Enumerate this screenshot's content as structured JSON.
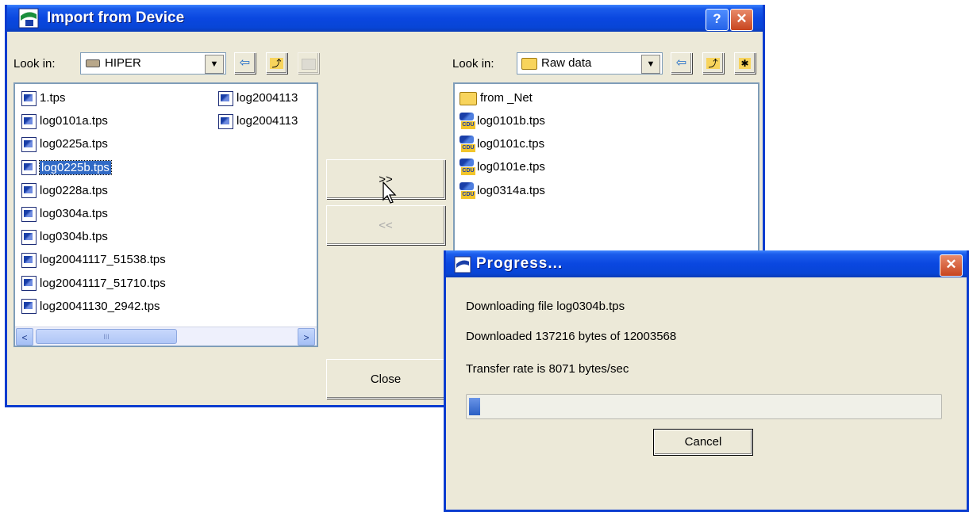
{
  "import_dialog": {
    "title": "Import from Device",
    "help_label": "?",
    "close_glyph": "✕",
    "left": {
      "look_in_label": "Look in:",
      "location": "HIPER",
      "back_icon": "⇦",
      "up_icon": "⤴",
      "files_col1": [
        "1.tps",
        "log0101a.tps",
        "log0225a.tps",
        "log0225b.tps",
        "log0228a.tps",
        "log0304a.tps",
        "log0304b.tps",
        "log20041117_51538.tps",
        "log20041117_51710.tps",
        "log20041130_2942.tps"
      ],
      "files_col2": [
        "log2004113",
        "log2004113"
      ],
      "selected": "log0225b.tps",
      "scroll_left": "<",
      "scroll_right": ">",
      "thumb_grip": "III"
    },
    "right": {
      "look_in_label": "Look in:",
      "location": "Raw data",
      "back_icon": "⇦",
      "up_icon": "⤴",
      "new_folder_icon": "✱",
      "folder": "from _Net",
      "files": [
        "log0101b.tps",
        "log0101c.tps",
        "log0101e.tps",
        "log0314a.tps"
      ]
    },
    "transfer_right_label": ">>",
    "transfer_left_label": "<<",
    "close_label": "Close"
  },
  "progress_dialog": {
    "title": "Progress...",
    "close_glyph": "✕",
    "line_file": "Downloading file log0304b.tps",
    "line_bytes": "Downloaded 137216 bytes of 12003568",
    "line_rate": "Transfer rate is 8071 bytes/sec",
    "progress_fraction": 0.0114,
    "cancel_label": "Cancel"
  },
  "colors": {
    "titlebar": "#0A47E0",
    "dialog_bg": "#ECE9D8",
    "selection": "#316AC5",
    "progress_fill": "#3166C5"
  }
}
